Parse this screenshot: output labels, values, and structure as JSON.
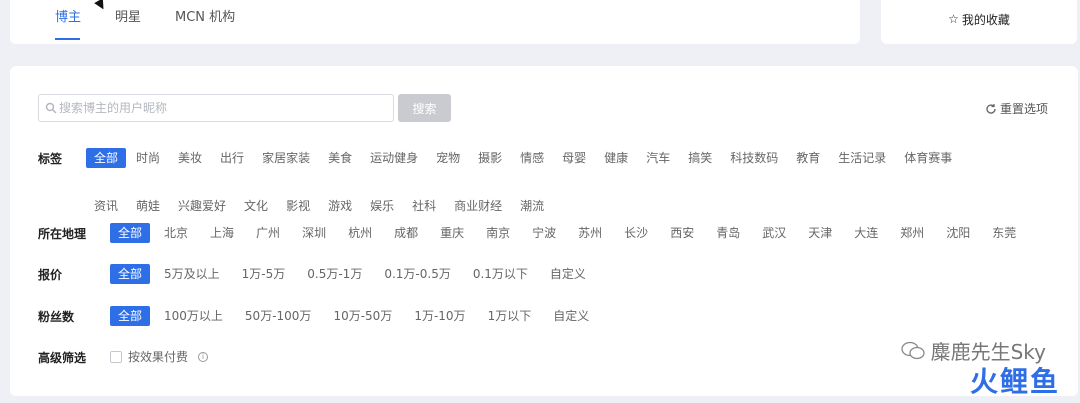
{
  "tabs": [
    {
      "label": "博主",
      "active": true
    },
    {
      "label": "明星",
      "active": false
    },
    {
      "label": "MCN 机构",
      "active": false
    }
  ],
  "favorites": {
    "label": "我的收藏",
    "icon": "star-outline-icon"
  },
  "search": {
    "placeholder": "搜索博主的用户昵称",
    "button": "搜索"
  },
  "reset": {
    "label": "重置选项",
    "icon": "refresh-icon"
  },
  "filters": {
    "tags": {
      "label": "标签",
      "options": [
        "全部",
        "时尚",
        "美妆",
        "出行",
        "家居家装",
        "美食",
        "运动健身",
        "宠物",
        "摄影",
        "情感",
        "母婴",
        "健康",
        "汽车",
        "搞笑",
        "科技数码",
        "教育",
        "生活记录",
        "体育赛事",
        "资讯",
        "萌娃",
        "兴趣爱好",
        "文化",
        "影视",
        "游戏",
        "娱乐",
        "社科",
        "商业财经",
        "潮流"
      ],
      "selected": "全部"
    },
    "location": {
      "label": "所在地理",
      "options": [
        "全部",
        "北京",
        "上海",
        "广州",
        "深圳",
        "杭州",
        "成都",
        "重庆",
        "南京",
        "宁波",
        "苏州",
        "长沙",
        "西安",
        "青岛",
        "武汉",
        "天津",
        "大连",
        "郑州",
        "沈阳",
        "东莞"
      ],
      "selected": "全部"
    },
    "price": {
      "label": "报价",
      "options": [
        "全部",
        "5万及以上",
        "1万-5万",
        "0.5万-1万",
        "0.1万-0.5万",
        "0.1万以下",
        "自定义"
      ],
      "selected": "全部"
    },
    "fans": {
      "label": "粉丝数",
      "options": [
        "全部",
        "100万以上",
        "50万-100万",
        "10万-50万",
        "1万-10万",
        "1万以下",
        "自定义"
      ],
      "selected": "全部"
    }
  },
  "advanced": {
    "label": "高级筛选",
    "checkbox_label": "按效果付费",
    "checked": false
  },
  "watermark": {
    "text": "麋鹿先生Sky",
    "brand": "火鲤鱼"
  },
  "colors": {
    "accent": "#2e6ee6",
    "background": "#eef0f6"
  }
}
